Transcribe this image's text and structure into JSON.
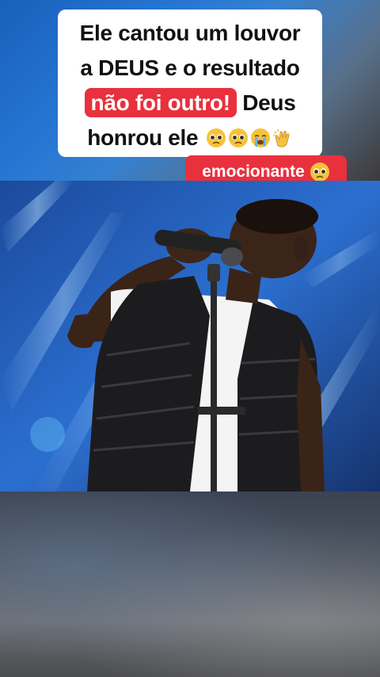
{
  "caption": {
    "line1": "Ele cantou um louvor",
    "line2": "a DEUS e o resultado",
    "line3_highlight": "não foi outro!",
    "line3_rest": "Deus",
    "line4": "honrou ele"
  },
  "tag": {
    "label": "emocionante"
  },
  "colors": {
    "highlight": "#e9303d",
    "card": "#ffffff",
    "stage_blue": "#1f5fb0"
  },
  "icons": [
    "pleading-face-icon",
    "crying-face-icon",
    "clapping-hands-icon"
  ]
}
